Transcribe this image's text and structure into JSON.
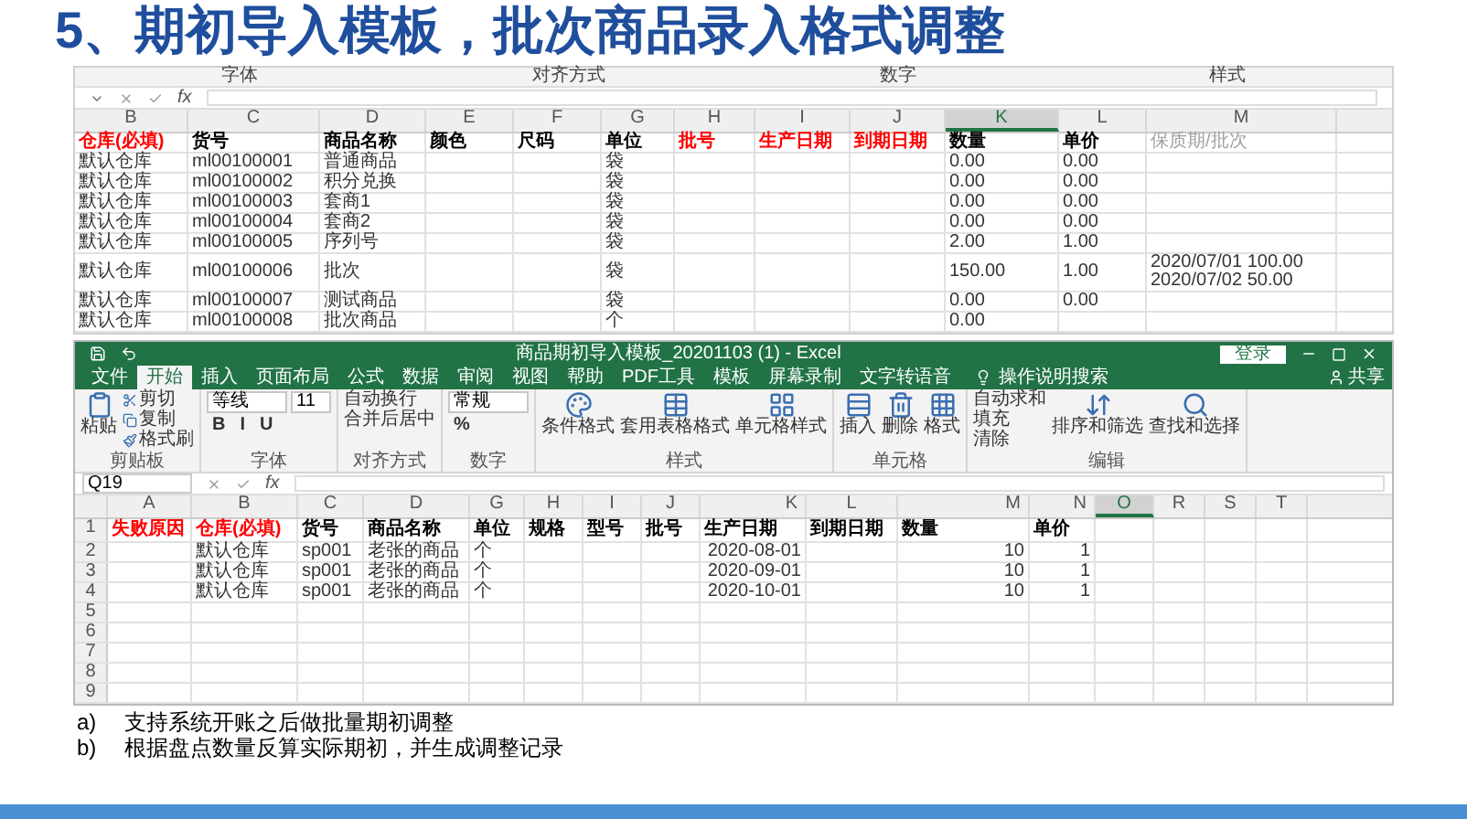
{
  "title": "5、期初导入模板，批次商品录入格式调整",
  "top_sheet": {
    "ribbon_groups": [
      "字体",
      "对齐方式",
      "数字",
      "样式"
    ],
    "formula_label": "fx",
    "columns": [
      {
        "letter": "B",
        "selected": false
      },
      {
        "letter": "C",
        "selected": false
      },
      {
        "letter": "D",
        "selected": false
      },
      {
        "letter": "E",
        "selected": false
      },
      {
        "letter": "F",
        "selected": false
      },
      {
        "letter": "G",
        "selected": false
      },
      {
        "letter": "H",
        "selected": false
      },
      {
        "letter": "I",
        "selected": false
      },
      {
        "letter": "J",
        "selected": false
      },
      {
        "letter": "K",
        "selected": true
      },
      {
        "letter": "L",
        "selected": false
      },
      {
        "letter": "M",
        "selected": false
      }
    ],
    "header_row": [
      {
        "text": "仓库(必填)",
        "kind": "required"
      },
      {
        "text": "货号",
        "kind": "plain"
      },
      {
        "text": "商品名称",
        "kind": "plain"
      },
      {
        "text": "颜色",
        "kind": "plain"
      },
      {
        "text": "尺码",
        "kind": "plain"
      },
      {
        "text": "单位",
        "kind": "plain"
      },
      {
        "text": "批号",
        "kind": "required"
      },
      {
        "text": "生产日期",
        "kind": "required"
      },
      {
        "text": "到期日期",
        "kind": "required"
      },
      {
        "text": "数量",
        "kind": "plain"
      },
      {
        "text": "单价",
        "kind": "plain"
      },
      {
        "text": "保质期/批次",
        "kind": "hint"
      }
    ],
    "rows": [
      {
        "B": "默认仓库",
        "C": "ml00100001",
        "D": "普通商品",
        "G": "袋",
        "K": "0.00",
        "L": "0.00"
      },
      {
        "B": "默认仓库",
        "C": "ml00100002",
        "D": "积分兑换",
        "G": "袋",
        "K": "0.00",
        "L": "0.00"
      },
      {
        "B": "默认仓库",
        "C": "ml00100003",
        "D": "套商1",
        "G": "袋",
        "K": "0.00",
        "L": "0.00"
      },
      {
        "B": "默认仓库",
        "C": "ml00100004",
        "D": "套商2",
        "G": "袋",
        "K": "0.00",
        "L": "0.00"
      },
      {
        "B": "默认仓库",
        "C": "ml00100005",
        "D": "序列号",
        "G": "袋",
        "K": "2.00",
        "L": "1.00"
      },
      {
        "B": "默认仓库",
        "C": "ml00100006",
        "D": "批次",
        "G": "袋",
        "K": "150.00",
        "L": "1.00",
        "M": [
          "2020/07/01 100.00",
          "2020/07/02 50.00"
        ]
      },
      {
        "B": "默认仓库",
        "C": "ml00100007",
        "D": "测试商品",
        "G": "袋",
        "K": "0.00",
        "L": "0.00"
      },
      {
        "B": "默认仓库",
        "C": "ml00100008",
        "D": "批次商品",
        "G": "个",
        "K": "0.00"
      }
    ]
  },
  "excel": {
    "window_title": "商品期初导入模板_20201103 (1)  -  Excel",
    "login": "登录",
    "share": "共享",
    "search": "操作说明搜索",
    "tabs": [
      {
        "label": "文件",
        "selected": false
      },
      {
        "label": "开始",
        "selected": true
      },
      {
        "label": "插入",
        "selected": false
      },
      {
        "label": "页面布局",
        "selected": false
      },
      {
        "label": "公式",
        "selected": false
      },
      {
        "label": "数据",
        "selected": false
      },
      {
        "label": "审阅",
        "selected": false
      },
      {
        "label": "视图",
        "selected": false
      },
      {
        "label": "帮助",
        "selected": false
      },
      {
        "label": "PDF工具",
        "selected": false
      },
      {
        "label": "模板",
        "selected": false
      },
      {
        "label": "屏幕录制",
        "selected": false
      },
      {
        "label": "文字转语音",
        "selected": false
      }
    ],
    "ribbon": [
      {
        "label": "剪贴板",
        "blocks": [
          {
            "kind": "large",
            "text": "粘贴"
          },
          {
            "kind": "stack",
            "items": [
              "剪切",
              "复制",
              "格式刷"
            ]
          }
        ]
      },
      {
        "label": "字体",
        "blocks": [
          {
            "kind": "fields",
            "dropdowns": [
              "等线",
              "11"
            ],
            "buttons": [
              "B",
              "I",
              "U"
            ]
          }
        ]
      },
      {
        "label": "对齐方式",
        "blocks": [
          {
            "kind": "stack",
            "items": [
              "自动换行",
              "合并后居中"
            ]
          }
        ]
      },
      {
        "label": "数字",
        "blocks": [
          {
            "kind": "fields",
            "dropdowns": [
              "常规"
            ],
            "buttons": [
              "%"
            ]
          }
        ]
      },
      {
        "label": "样式",
        "blocks": [
          {
            "kind": "large",
            "text": "条件格式"
          },
          {
            "kind": "large",
            "text": "套用表格格式"
          },
          {
            "kind": "large",
            "text": "单元格样式"
          }
        ]
      },
      {
        "label": "单元格",
        "blocks": [
          {
            "kind": "large",
            "text": "插入"
          },
          {
            "kind": "large",
            "text": "删除"
          },
          {
            "kind": "large",
            "text": "格式"
          }
        ]
      },
      {
        "label": "编辑",
        "blocks": [
          {
            "kind": "stack",
            "items": [
              "自动求和",
              "填充",
              "清除"
            ]
          },
          {
            "kind": "large",
            "text": "排序和筛选"
          },
          {
            "kind": "large",
            "text": "查找和选择"
          }
        ]
      }
    ],
    "name_box": "Q19",
    "formula_label": "fx",
    "columns": [
      {
        "letter": "A",
        "selected": false
      },
      {
        "letter": "B",
        "selected": false
      },
      {
        "letter": "C",
        "selected": false
      },
      {
        "letter": "D",
        "selected": false
      },
      {
        "letter": "G",
        "selected": false
      },
      {
        "letter": "H",
        "selected": false
      },
      {
        "letter": "I",
        "selected": false
      },
      {
        "letter": "J",
        "selected": false
      },
      {
        "letter": "K",
        "selected": false,
        "numeric": true
      },
      {
        "letter": "L",
        "selected": false
      },
      {
        "letter": "M",
        "selected": false,
        "numeric": true
      },
      {
        "letter": "N",
        "selected": false,
        "numeric": true
      },
      {
        "letter": "O",
        "selected": true
      },
      {
        "letter": "R",
        "selected": false
      },
      {
        "letter": "S",
        "selected": false
      },
      {
        "letter": "T",
        "selected": false
      }
    ],
    "rows": [
      {
        "number": "1",
        "header": true,
        "cells": {
          "A": {
            "text": "失败原因",
            "kind": "required"
          },
          "B": {
            "text": "仓库(必填)",
            "kind": "required"
          },
          "C": {
            "text": "货号",
            "kind": "plain"
          },
          "D": {
            "text": "商品名称",
            "kind": "plain"
          },
          "G": {
            "text": "单位",
            "kind": "plain"
          },
          "H": {
            "text": "规格",
            "kind": "plain"
          },
          "I": {
            "text": "型号",
            "kind": "plain"
          },
          "J": {
            "text": "批号",
            "kind": "plain"
          },
          "K": {
            "text": "生产日期",
            "kind": "plain"
          },
          "L": {
            "text": "到期日期",
            "kind": "plain"
          },
          "M": {
            "text": "数量",
            "kind": "plain"
          },
          "N": {
            "text": "单价",
            "kind": "plain"
          }
        }
      },
      {
        "number": "2",
        "header": false,
        "cells": {
          "B": {
            "text": "默认仓库"
          },
          "C": {
            "text": "sp001"
          },
          "D": {
            "text": "老张的商品"
          },
          "G": {
            "text": "个"
          },
          "K": {
            "text": "2020-08-01"
          },
          "M": {
            "text": "10"
          },
          "N": {
            "text": "1"
          }
        }
      },
      {
        "number": "3",
        "header": false,
        "cells": {
          "B": {
            "text": "默认仓库"
          },
          "C": {
            "text": "sp001"
          },
          "D": {
            "text": "老张的商品"
          },
          "G": {
            "text": "个"
          },
          "K": {
            "text": "2020-09-01"
          },
          "M": {
            "text": "10"
          },
          "N": {
            "text": "1"
          }
        }
      },
      {
        "number": "4",
        "header": false,
        "cells": {
          "B": {
            "text": "默认仓库"
          },
          "C": {
            "text": "sp001"
          },
          "D": {
            "text": "老张的商品"
          },
          "G": {
            "text": "个"
          },
          "K": {
            "text": "2020-10-01"
          },
          "M": {
            "text": "10"
          },
          "N": {
            "text": "1"
          }
        }
      },
      {
        "number": "5",
        "header": false,
        "cells": {}
      },
      {
        "number": "6",
        "header": false,
        "cells": {}
      },
      {
        "number": "7",
        "header": false,
        "cells": {}
      },
      {
        "number": "8",
        "header": false,
        "cells": {}
      },
      {
        "number": "9",
        "header": false,
        "cells": {}
      }
    ]
  },
  "bullets": [
    {
      "marker": "a)",
      "text": "支持系统开账之后做批量期初调整"
    },
    {
      "marker": "b)",
      "text": "根据盘点数量反算实际期初，并生成调整记录"
    }
  ]
}
